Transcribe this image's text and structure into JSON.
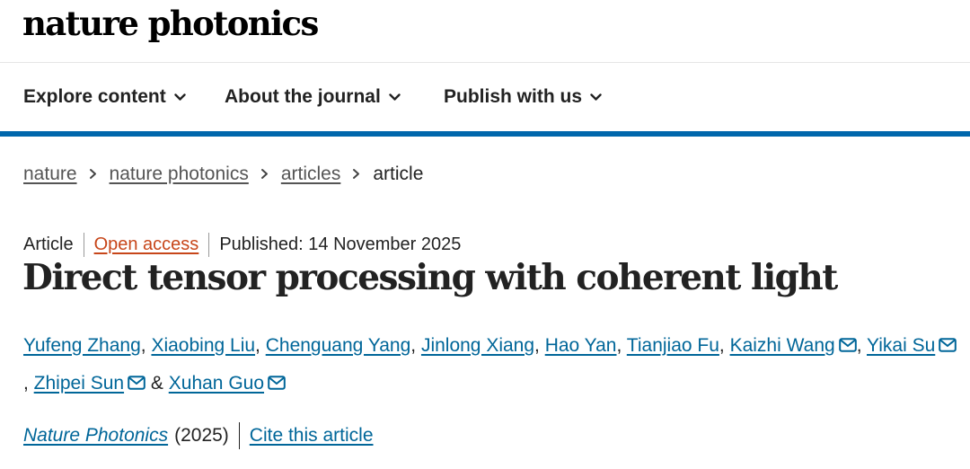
{
  "site": {
    "brand": "nature photonics"
  },
  "nav": [
    {
      "label": "Explore content"
    },
    {
      "label": "About the journal"
    },
    {
      "label": "Publish with us"
    }
  ],
  "breadcrumb": [
    {
      "label": "nature",
      "link": true
    },
    {
      "label": "nature photonics",
      "link": true
    },
    {
      "label": "articles",
      "link": true
    },
    {
      "label": "article",
      "link": false
    }
  ],
  "article": {
    "type": "Article",
    "access": "Open access",
    "published": "Published: 14 November 2025",
    "title": "Direct tensor processing with coherent light",
    "authors": [
      {
        "name": "Yufeng Zhang",
        "email_icon": false
      },
      {
        "name": "Xiaobing Liu",
        "email_icon": false
      },
      {
        "name": "Chenguang Yang",
        "email_icon": false
      },
      {
        "name": "Jinlong Xiang",
        "email_icon": false
      },
      {
        "name": "Hao Yan",
        "email_icon": false
      },
      {
        "name": "Tianjiao Fu",
        "email_icon": false
      },
      {
        "name": "Kaizhi Wang",
        "email_icon": true
      },
      {
        "name": "Yikai Su",
        "email_icon": true
      },
      {
        "name": "Zhipei Sun",
        "email_icon": true
      },
      {
        "name": "Xuhan Guo",
        "email_icon": true
      }
    ],
    "author_separator": ", ",
    "author_last_separator": " & ",
    "journal": "Nature Photonics",
    "year": "(2025)",
    "cite_label": "Cite this article"
  },
  "colors": {
    "accent_rule": "#0067ac",
    "link": "#006699",
    "open_access": "#c7461a"
  },
  "icons": {
    "nav_chevron": "chevron-down-icon",
    "breadcrumb_separator": "chevron-right-icon",
    "author_email": "envelope-icon"
  }
}
